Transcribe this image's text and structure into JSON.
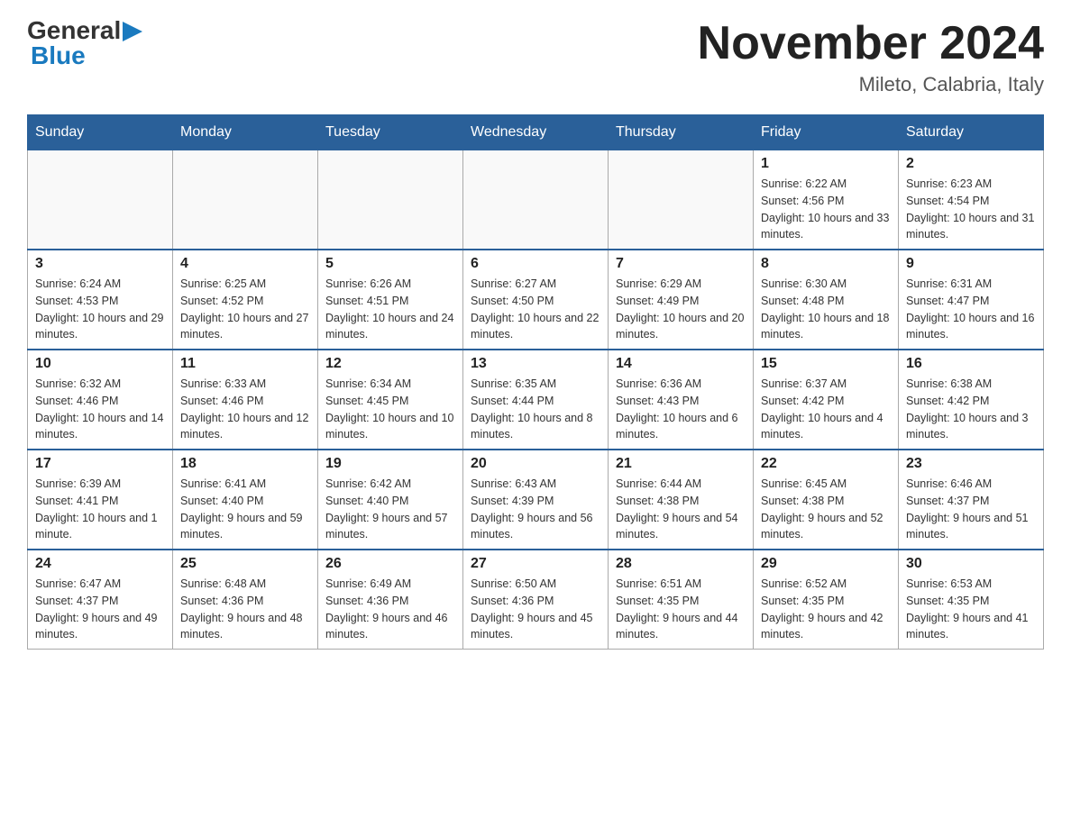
{
  "header": {
    "logo_general": "General",
    "logo_blue": "Blue",
    "month_title": "November 2024",
    "location": "Mileto, Calabria, Italy"
  },
  "days_of_week": [
    "Sunday",
    "Monday",
    "Tuesday",
    "Wednesday",
    "Thursday",
    "Friday",
    "Saturday"
  ],
  "weeks": [
    [
      {
        "day": "",
        "info": ""
      },
      {
        "day": "",
        "info": ""
      },
      {
        "day": "",
        "info": ""
      },
      {
        "day": "",
        "info": ""
      },
      {
        "day": "",
        "info": ""
      },
      {
        "day": "1",
        "info": "Sunrise: 6:22 AM\nSunset: 4:56 PM\nDaylight: 10 hours and 33 minutes."
      },
      {
        "day": "2",
        "info": "Sunrise: 6:23 AM\nSunset: 4:54 PM\nDaylight: 10 hours and 31 minutes."
      }
    ],
    [
      {
        "day": "3",
        "info": "Sunrise: 6:24 AM\nSunset: 4:53 PM\nDaylight: 10 hours and 29 minutes."
      },
      {
        "day": "4",
        "info": "Sunrise: 6:25 AM\nSunset: 4:52 PM\nDaylight: 10 hours and 27 minutes."
      },
      {
        "day": "5",
        "info": "Sunrise: 6:26 AM\nSunset: 4:51 PM\nDaylight: 10 hours and 24 minutes."
      },
      {
        "day": "6",
        "info": "Sunrise: 6:27 AM\nSunset: 4:50 PM\nDaylight: 10 hours and 22 minutes."
      },
      {
        "day": "7",
        "info": "Sunrise: 6:29 AM\nSunset: 4:49 PM\nDaylight: 10 hours and 20 minutes."
      },
      {
        "day": "8",
        "info": "Sunrise: 6:30 AM\nSunset: 4:48 PM\nDaylight: 10 hours and 18 minutes."
      },
      {
        "day": "9",
        "info": "Sunrise: 6:31 AM\nSunset: 4:47 PM\nDaylight: 10 hours and 16 minutes."
      }
    ],
    [
      {
        "day": "10",
        "info": "Sunrise: 6:32 AM\nSunset: 4:46 PM\nDaylight: 10 hours and 14 minutes."
      },
      {
        "day": "11",
        "info": "Sunrise: 6:33 AM\nSunset: 4:46 PM\nDaylight: 10 hours and 12 minutes."
      },
      {
        "day": "12",
        "info": "Sunrise: 6:34 AM\nSunset: 4:45 PM\nDaylight: 10 hours and 10 minutes."
      },
      {
        "day": "13",
        "info": "Sunrise: 6:35 AM\nSunset: 4:44 PM\nDaylight: 10 hours and 8 minutes."
      },
      {
        "day": "14",
        "info": "Sunrise: 6:36 AM\nSunset: 4:43 PM\nDaylight: 10 hours and 6 minutes."
      },
      {
        "day": "15",
        "info": "Sunrise: 6:37 AM\nSunset: 4:42 PM\nDaylight: 10 hours and 4 minutes."
      },
      {
        "day": "16",
        "info": "Sunrise: 6:38 AM\nSunset: 4:42 PM\nDaylight: 10 hours and 3 minutes."
      }
    ],
    [
      {
        "day": "17",
        "info": "Sunrise: 6:39 AM\nSunset: 4:41 PM\nDaylight: 10 hours and 1 minute."
      },
      {
        "day": "18",
        "info": "Sunrise: 6:41 AM\nSunset: 4:40 PM\nDaylight: 9 hours and 59 minutes."
      },
      {
        "day": "19",
        "info": "Sunrise: 6:42 AM\nSunset: 4:40 PM\nDaylight: 9 hours and 57 minutes."
      },
      {
        "day": "20",
        "info": "Sunrise: 6:43 AM\nSunset: 4:39 PM\nDaylight: 9 hours and 56 minutes."
      },
      {
        "day": "21",
        "info": "Sunrise: 6:44 AM\nSunset: 4:38 PM\nDaylight: 9 hours and 54 minutes."
      },
      {
        "day": "22",
        "info": "Sunrise: 6:45 AM\nSunset: 4:38 PM\nDaylight: 9 hours and 52 minutes."
      },
      {
        "day": "23",
        "info": "Sunrise: 6:46 AM\nSunset: 4:37 PM\nDaylight: 9 hours and 51 minutes."
      }
    ],
    [
      {
        "day": "24",
        "info": "Sunrise: 6:47 AM\nSunset: 4:37 PM\nDaylight: 9 hours and 49 minutes."
      },
      {
        "day": "25",
        "info": "Sunrise: 6:48 AM\nSunset: 4:36 PM\nDaylight: 9 hours and 48 minutes."
      },
      {
        "day": "26",
        "info": "Sunrise: 6:49 AM\nSunset: 4:36 PM\nDaylight: 9 hours and 46 minutes."
      },
      {
        "day": "27",
        "info": "Sunrise: 6:50 AM\nSunset: 4:36 PM\nDaylight: 9 hours and 45 minutes."
      },
      {
        "day": "28",
        "info": "Sunrise: 6:51 AM\nSunset: 4:35 PM\nDaylight: 9 hours and 44 minutes."
      },
      {
        "day": "29",
        "info": "Sunrise: 6:52 AM\nSunset: 4:35 PM\nDaylight: 9 hours and 42 minutes."
      },
      {
        "day": "30",
        "info": "Sunrise: 6:53 AM\nSunset: 4:35 PM\nDaylight: 9 hours and 41 minutes."
      }
    ]
  ]
}
